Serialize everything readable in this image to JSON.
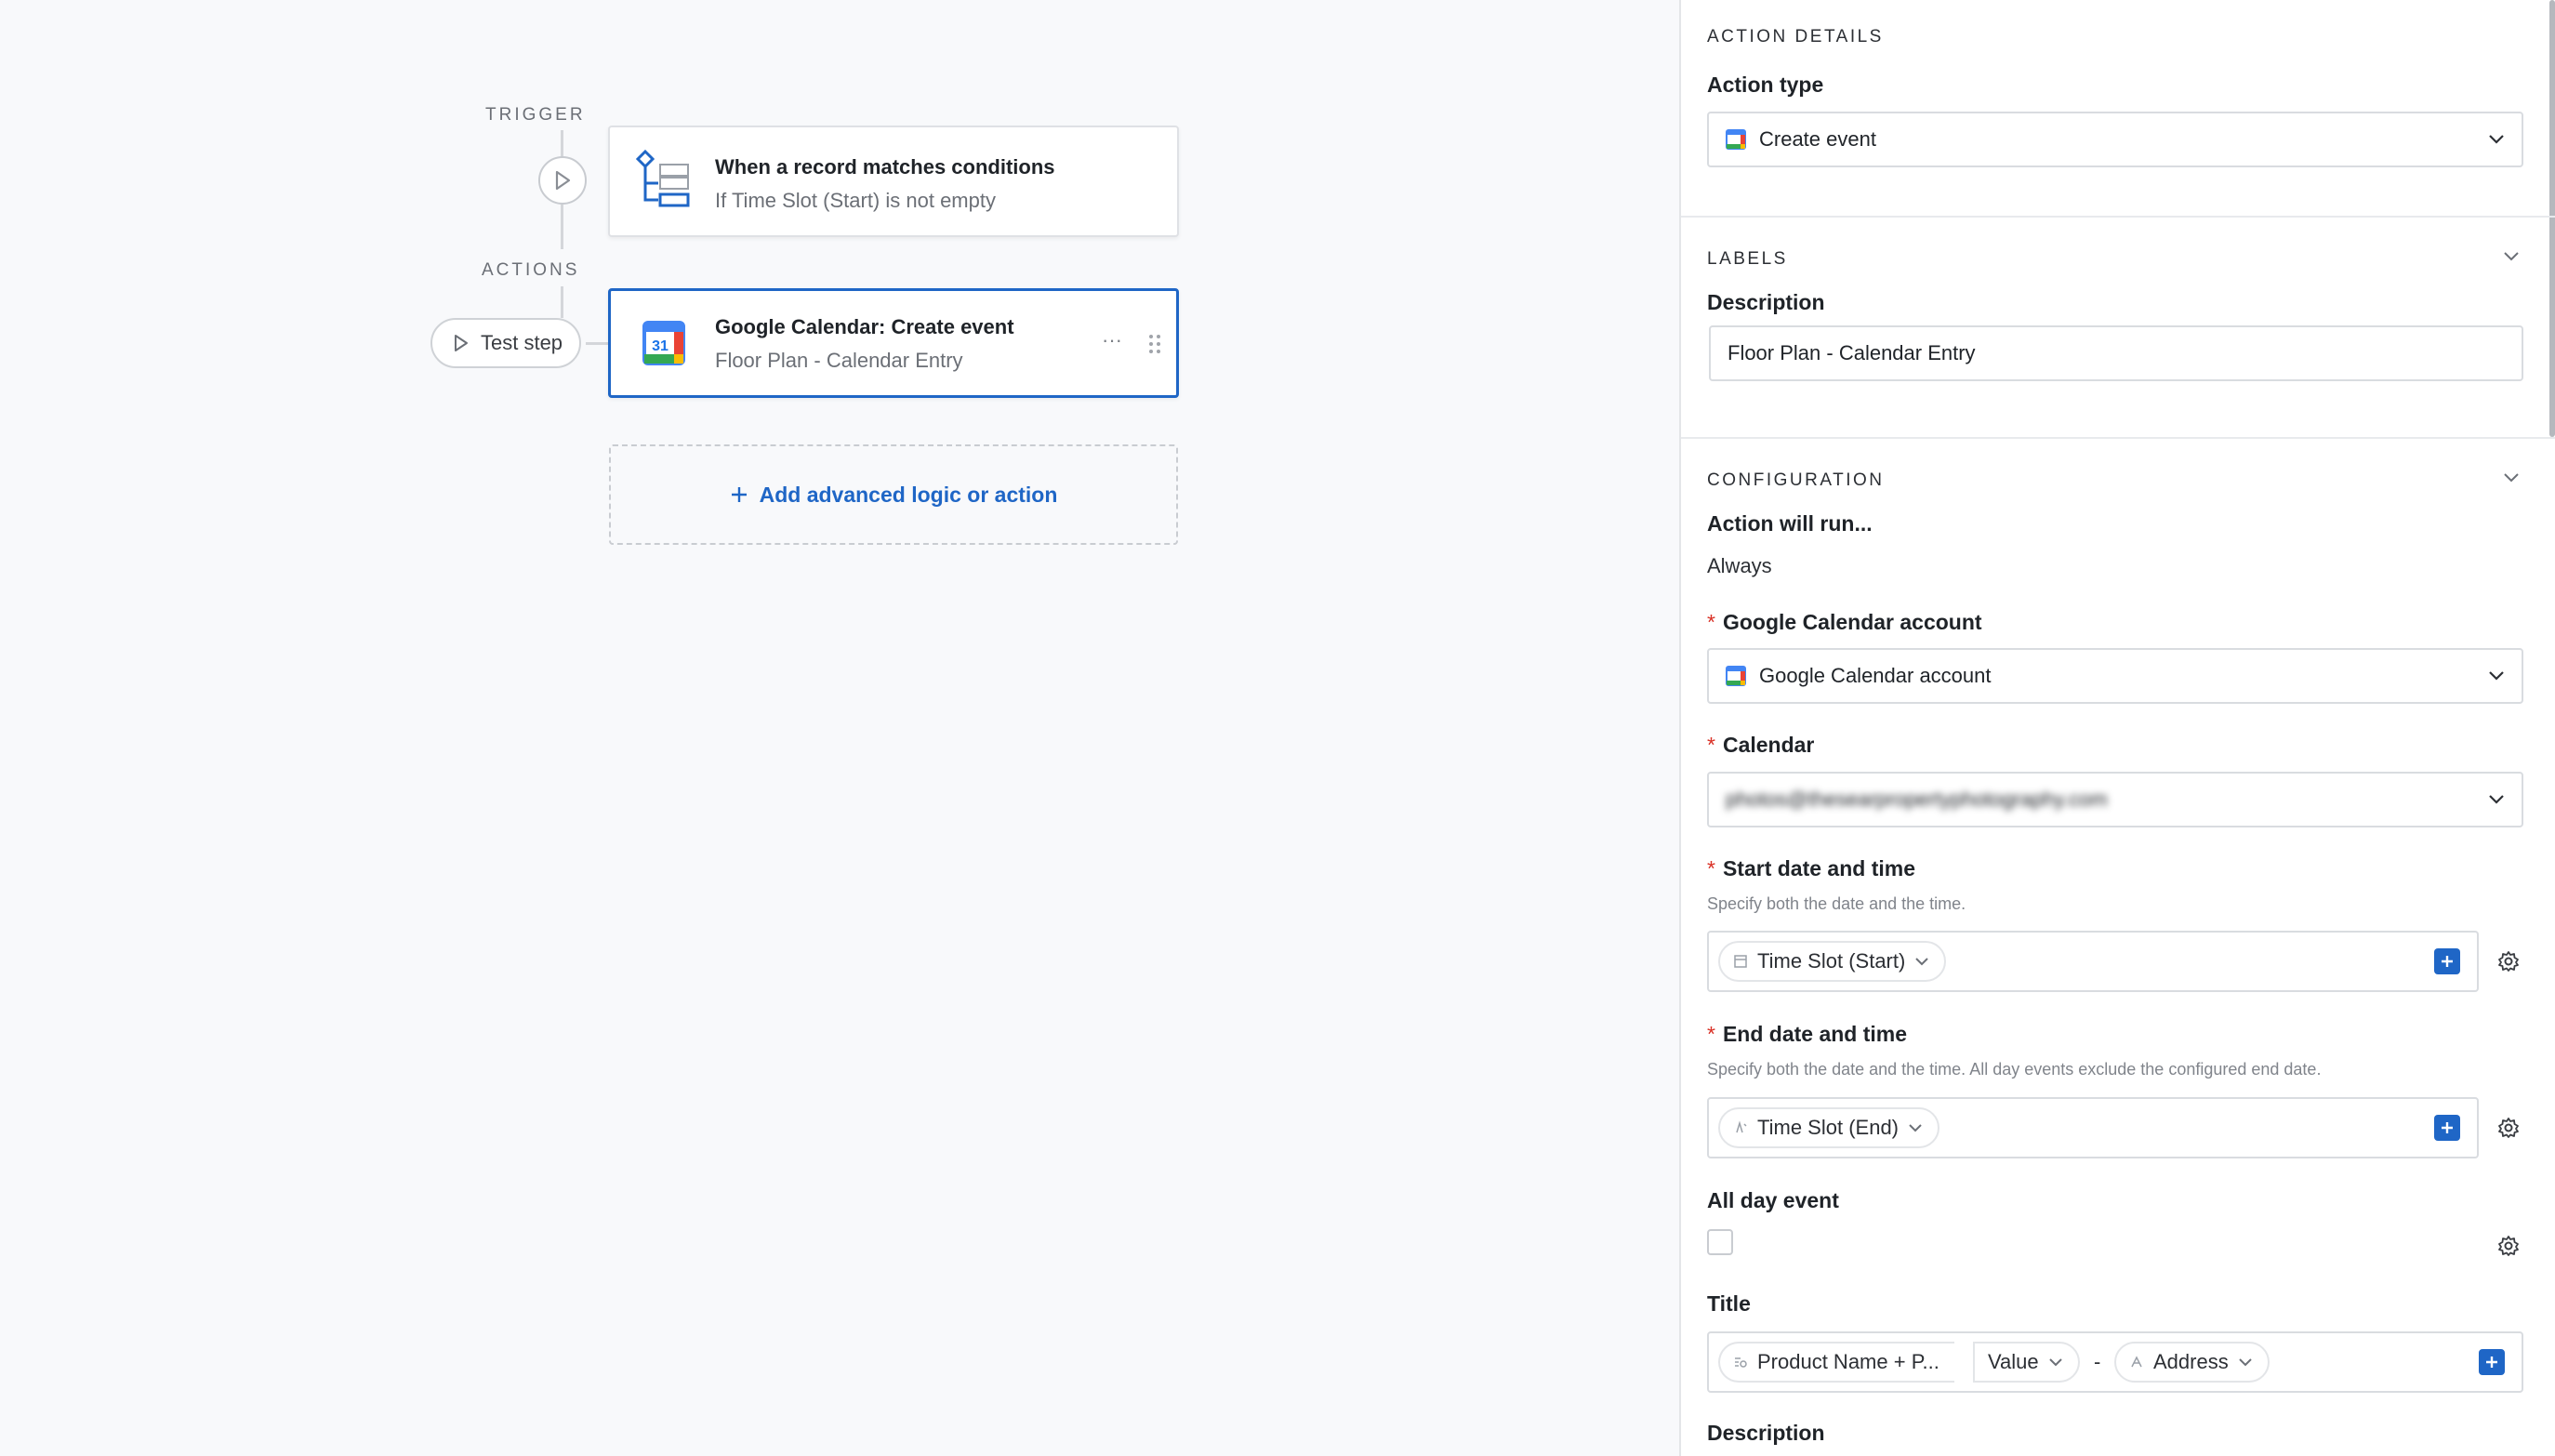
{
  "canvas": {
    "trigger_label": "TRIGGER",
    "actions_label": "ACTIONS",
    "trigger_card": {
      "title": "When a record matches conditions",
      "subtitle": "If Time Slot (Start) is not empty",
      "icon": "record-conditions-icon"
    },
    "action_card": {
      "title": "Google Calendar: Create event",
      "subtitle": "Floor Plan - Calendar Entry",
      "icon": "google-calendar-icon",
      "icon_text": "31",
      "more_label": "···"
    },
    "test_step_label": "Test step",
    "add_action_label": "Add advanced logic or action"
  },
  "panel": {
    "action_details_heading": "ACTION DETAILS",
    "action_type_label": "Action type",
    "action_type_value": "Create event",
    "labels_heading": "LABELS",
    "description_label": "Description",
    "description_value": "Floor Plan - Calendar Entry",
    "configuration_heading": "CONFIGURATION",
    "action_will_run_label": "Action will run...",
    "action_will_run_value": "Always",
    "account_label": "Google Calendar account",
    "account_value": "Google Calendar account",
    "calendar_label": "Calendar",
    "calendar_value": "photos@thesearpropertyphotography.com",
    "start_label": "Start date and time",
    "start_help": "Specify both the date and the time.",
    "start_token": "Time Slot (Start)",
    "end_label": "End date and time",
    "end_help": "Specify both the date and the time. All day events exclude the configured end date.",
    "end_token": "Time Slot (End)",
    "all_day_label": "All day event",
    "title_label": "Title",
    "title_token_1": "Product Name + P...",
    "title_token_2": "Value",
    "title_separator": "-",
    "title_token_3": "Address",
    "description2_label": "Description",
    "required_mark": "*"
  },
  "colors": {
    "accent": "#1f66c6",
    "required": "#d93025",
    "canvas_bg": "#f8f9fb"
  }
}
